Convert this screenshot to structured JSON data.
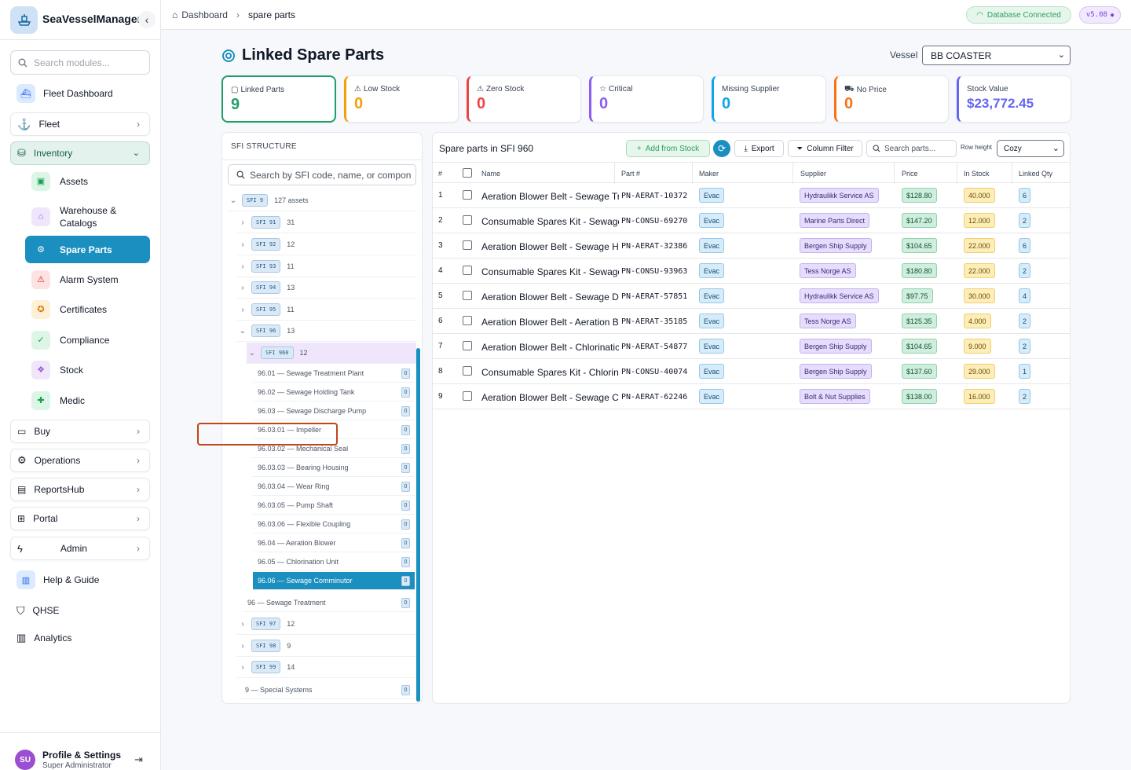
{
  "app": {
    "name": "SeaVesselManager",
    "search_placeholder": "Search modules..."
  },
  "sidebar": {
    "fleet_dashboard": "Fleet Dashboard",
    "fleet": "Fleet",
    "inventory": "Inventory",
    "inventory_children": {
      "assets": "Assets",
      "warehouse_line1": "Warehouse &",
      "warehouse_line2": "Catalogs",
      "spare_parts": "Spare Parts",
      "alarm_system": "Alarm System",
      "certificates": "Certificates",
      "compliance": "Compliance",
      "stock": "Stock",
      "medic": "Medic"
    },
    "buy": "Buy",
    "operations": "Operations",
    "reportshub": "ReportsHub",
    "portal": "Portal",
    "admin": "Admin",
    "help": "Help & Guide",
    "qhse": "QHSE",
    "analytics": "Analytics"
  },
  "profile": {
    "initials": "SU",
    "name": "Profile & Settings",
    "role": "Super Administrator"
  },
  "topbar": {
    "crumb_home": "Dashboard",
    "crumb_current": "spare parts",
    "db_status": "Database Connected",
    "version": "v5.08"
  },
  "page": {
    "title": "Linked Spare Parts",
    "vessel_label": "Vessel",
    "vessel_value": "BB COASTER"
  },
  "stats": [
    {
      "label": "Linked Parts",
      "value": "9",
      "color": "#1f9e6a"
    },
    {
      "label": "Low Stock",
      "value": "0",
      "color": "#f59e0b"
    },
    {
      "label": "Zero Stock",
      "value": "0",
      "color": "#ef4444"
    },
    {
      "label": "Critical",
      "value": "0",
      "color": "#8b5cf6"
    },
    {
      "label": "Missing Supplier",
      "value": "0",
      "color": "#0ea5e9"
    },
    {
      "label": "No Price",
      "value": "0",
      "color": "#f97316"
    },
    {
      "label": "Stock Value",
      "value": "$23,772.45",
      "color": "#6366f1"
    }
  ],
  "sfi": {
    "header": "SFI STRUCTURE",
    "search_placeholder": "Search by SFI code, name, or compon",
    "root": {
      "code": "SFI 9",
      "count": "127 assets"
    },
    "groups": [
      {
        "code": "SFI 91",
        "count": "31"
      },
      {
        "code": "SFI 92",
        "count": "12"
      },
      {
        "code": "SFI 93",
        "count": "11"
      },
      {
        "code": "SFI 94",
        "count": "13"
      },
      {
        "code": "SFI 95",
        "count": "11"
      },
      {
        "code": "SFI 96",
        "count": "13"
      }
    ],
    "expanded": {
      "code": "SFI 960",
      "count": "12"
    },
    "leaves": [
      {
        "label": "96.01 — Sewage Treatment Plant",
        "count": "0"
      },
      {
        "label": "96.02 — Sewage Holding Tank",
        "count": "0"
      },
      {
        "label": "96.03 — Sewage Discharge Pump",
        "count": "0"
      },
      {
        "label": "96.03.01 — Impeller",
        "count": "0"
      },
      {
        "label": "96.03.02 — Mechanical Seal",
        "count": "0"
      },
      {
        "label": "96.03.03 — Bearing Housing",
        "count": "0"
      },
      {
        "label": "96.03.04 — Wear Ring",
        "count": "0"
      },
      {
        "label": "96.03.05 — Pump Shaft",
        "count": "0"
      },
      {
        "label": "96.03.06 — Flexible Coupling",
        "count": "0"
      },
      {
        "label": "96.04 — Aeration Blower",
        "count": "0"
      },
      {
        "label": "96.05 — Chlorination Unit",
        "count": "0"
      },
      {
        "label": "96.06 — Sewage Comminutor",
        "count": "0"
      }
    ],
    "group_96_label": {
      "label": "96 — Sewage Treatment",
      "count": "0"
    },
    "tail_groups": [
      {
        "code": "SFI 97",
        "count": "12"
      },
      {
        "code": "SFI 98",
        "count": "9"
      },
      {
        "code": "SFI 99",
        "count": "14"
      }
    ],
    "root_label": {
      "label": "9 — Special Systems",
      "count": "0"
    }
  },
  "parts": {
    "title": "Spare parts in SFI 960",
    "add_from_stock": "Add from Stock",
    "export": "Export",
    "column_filter": "Column Filter",
    "search_placeholder": "Search parts...",
    "row_height_label": "Row height",
    "row_height_value": "Cozy",
    "columns": [
      "#",
      "Name",
      "Part #",
      "Maker",
      "Supplier",
      "Price",
      "In Stock",
      "Linked Qty"
    ],
    "rows": [
      {
        "n": "1",
        "name": "Aeration Blower Belt - Sewage Tr",
        "part": "PN-AERAT-10372",
        "maker": "Evac",
        "supplier": "Hydraulikk Service AS",
        "price": "$128.80",
        "stock": "40.000",
        "qty": "6"
      },
      {
        "n": "2",
        "name": "Consumable Spares Kit - Sewage",
        "part": "PN-CONSU-69270",
        "maker": "Evac",
        "supplier": "Marine Parts Direct",
        "price": "$147.20",
        "stock": "12.000",
        "qty": "2"
      },
      {
        "n": "3",
        "name": "Aeration Blower Belt - Sewage H",
        "part": "PN-AERAT-32386",
        "maker": "Evac",
        "supplier": "Bergen Ship Supply",
        "price": "$104.65",
        "stock": "22.000",
        "qty": "6"
      },
      {
        "n": "4",
        "name": "Consumable Spares Kit - Sewage",
        "part": "PN-CONSU-93963",
        "maker": "Evac",
        "supplier": "Tess Norge AS",
        "price": "$180.80",
        "stock": "22.000",
        "qty": "2"
      },
      {
        "n": "5",
        "name": "Aeration Blower Belt - Sewage D",
        "part": "PN-AERAT-57851",
        "maker": "Evac",
        "supplier": "Hydraulikk Service AS",
        "price": "$97.75",
        "stock": "30.000",
        "qty": "4"
      },
      {
        "n": "6",
        "name": "Aeration Blower Belt - Aeration B",
        "part": "PN-AERAT-35185",
        "maker": "Evac",
        "supplier": "Tess Norge AS",
        "price": "$125.35",
        "stock": "4.000",
        "qty": "2"
      },
      {
        "n": "7",
        "name": "Aeration Blower Belt - Chlorinatic",
        "part": "PN-AERAT-54877",
        "maker": "Evac",
        "supplier": "Bergen Ship Supply",
        "price": "$104.65",
        "stock": "9.000",
        "qty": "2"
      },
      {
        "n": "8",
        "name": "Consumable Spares Kit - Chlorin",
        "part": "PN-CONSU-40074",
        "maker": "Evac",
        "supplier": "Bergen Ship Supply",
        "price": "$137.60",
        "stock": "29.000",
        "qty": "1"
      },
      {
        "n": "9",
        "name": "Aeration Blower Belt - Sewage C",
        "part": "PN-AERAT-62246",
        "maker": "Evac",
        "supplier": "Bolt & Nut Supplies",
        "price": "$138.00",
        "stock": "16.000",
        "qty": "2"
      }
    ]
  }
}
